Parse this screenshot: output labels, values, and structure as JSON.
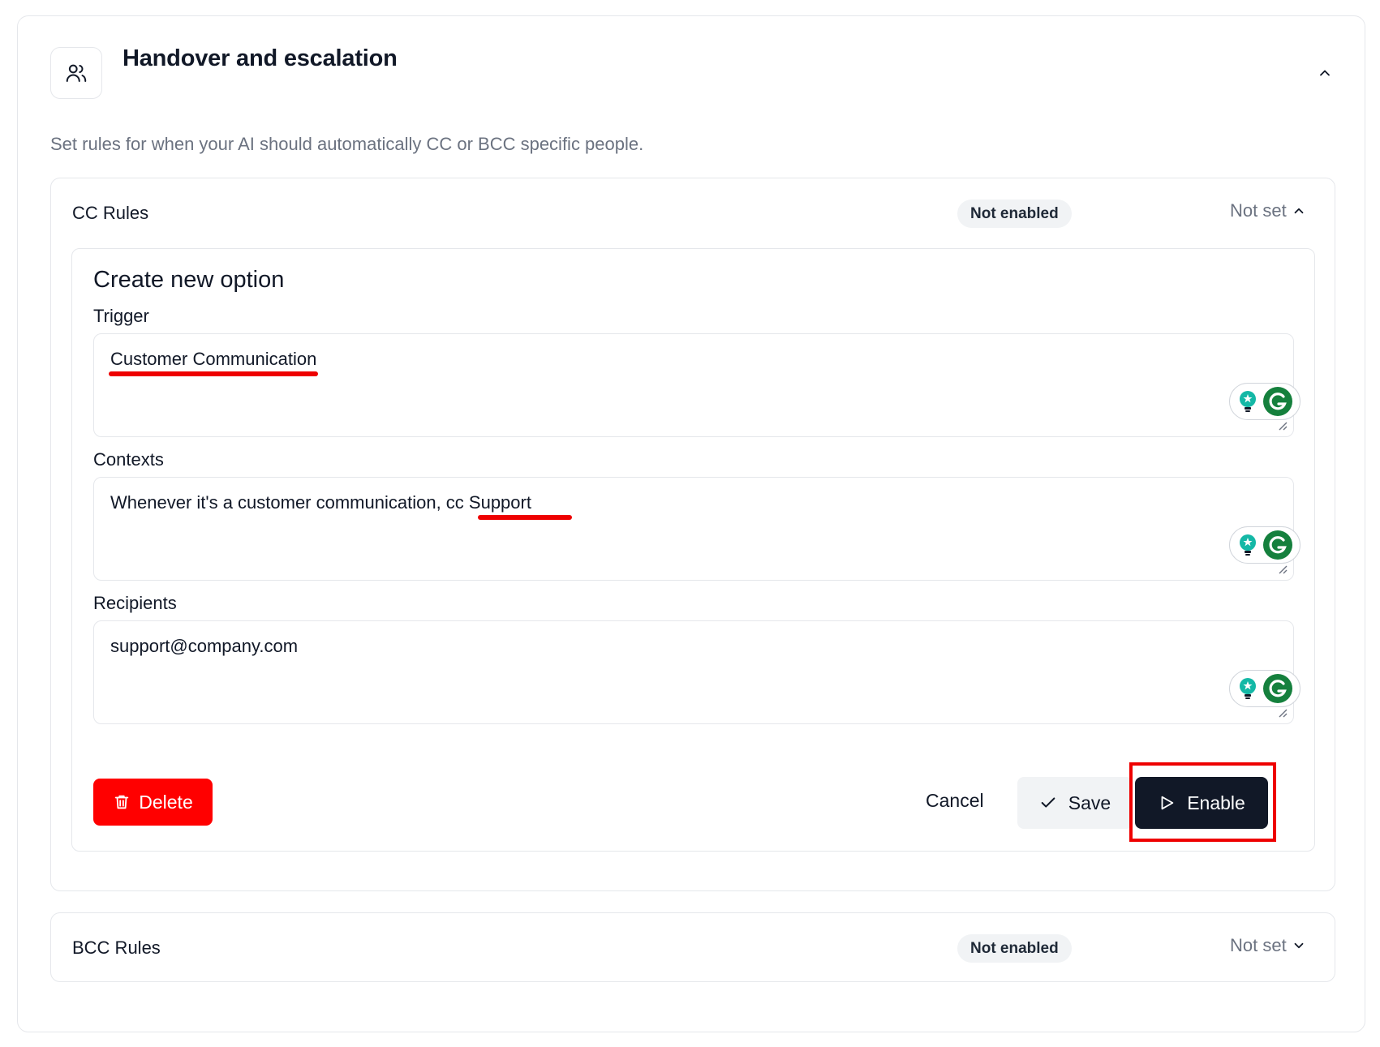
{
  "header": {
    "title": "Handover and escalation",
    "subtitle": "Set rules for when your AI should automatically CC or BCC specific people.",
    "icon": "users-icon"
  },
  "cc_rules": {
    "title": "CC Rules",
    "status": "Not enabled",
    "value": "Not set",
    "expanded": true,
    "option": {
      "heading": "Create new option",
      "trigger_label": "Trigger",
      "trigger_value": "Customer Communication",
      "contexts_label": "Contexts",
      "contexts_value": "Whenever it's a customer communication, cc Support",
      "recipients_label": "Recipients",
      "recipients_value": "support@company.com"
    },
    "actions": {
      "delete": "Delete",
      "cancel": "Cancel",
      "save": "Save",
      "enable": "Enable"
    }
  },
  "bcc_rules": {
    "title": "BCC Rules",
    "status": "Not enabled",
    "value": "Not set",
    "expanded": false
  },
  "colors": {
    "primary_dark": "#111827",
    "danger": "#ff0000",
    "annotation_red": "#ee0000",
    "muted_text": "#6b7280",
    "badge_bg": "#f1f3f5",
    "grammarly_green": "#15803d",
    "assistant_teal": "#14b8a6"
  }
}
